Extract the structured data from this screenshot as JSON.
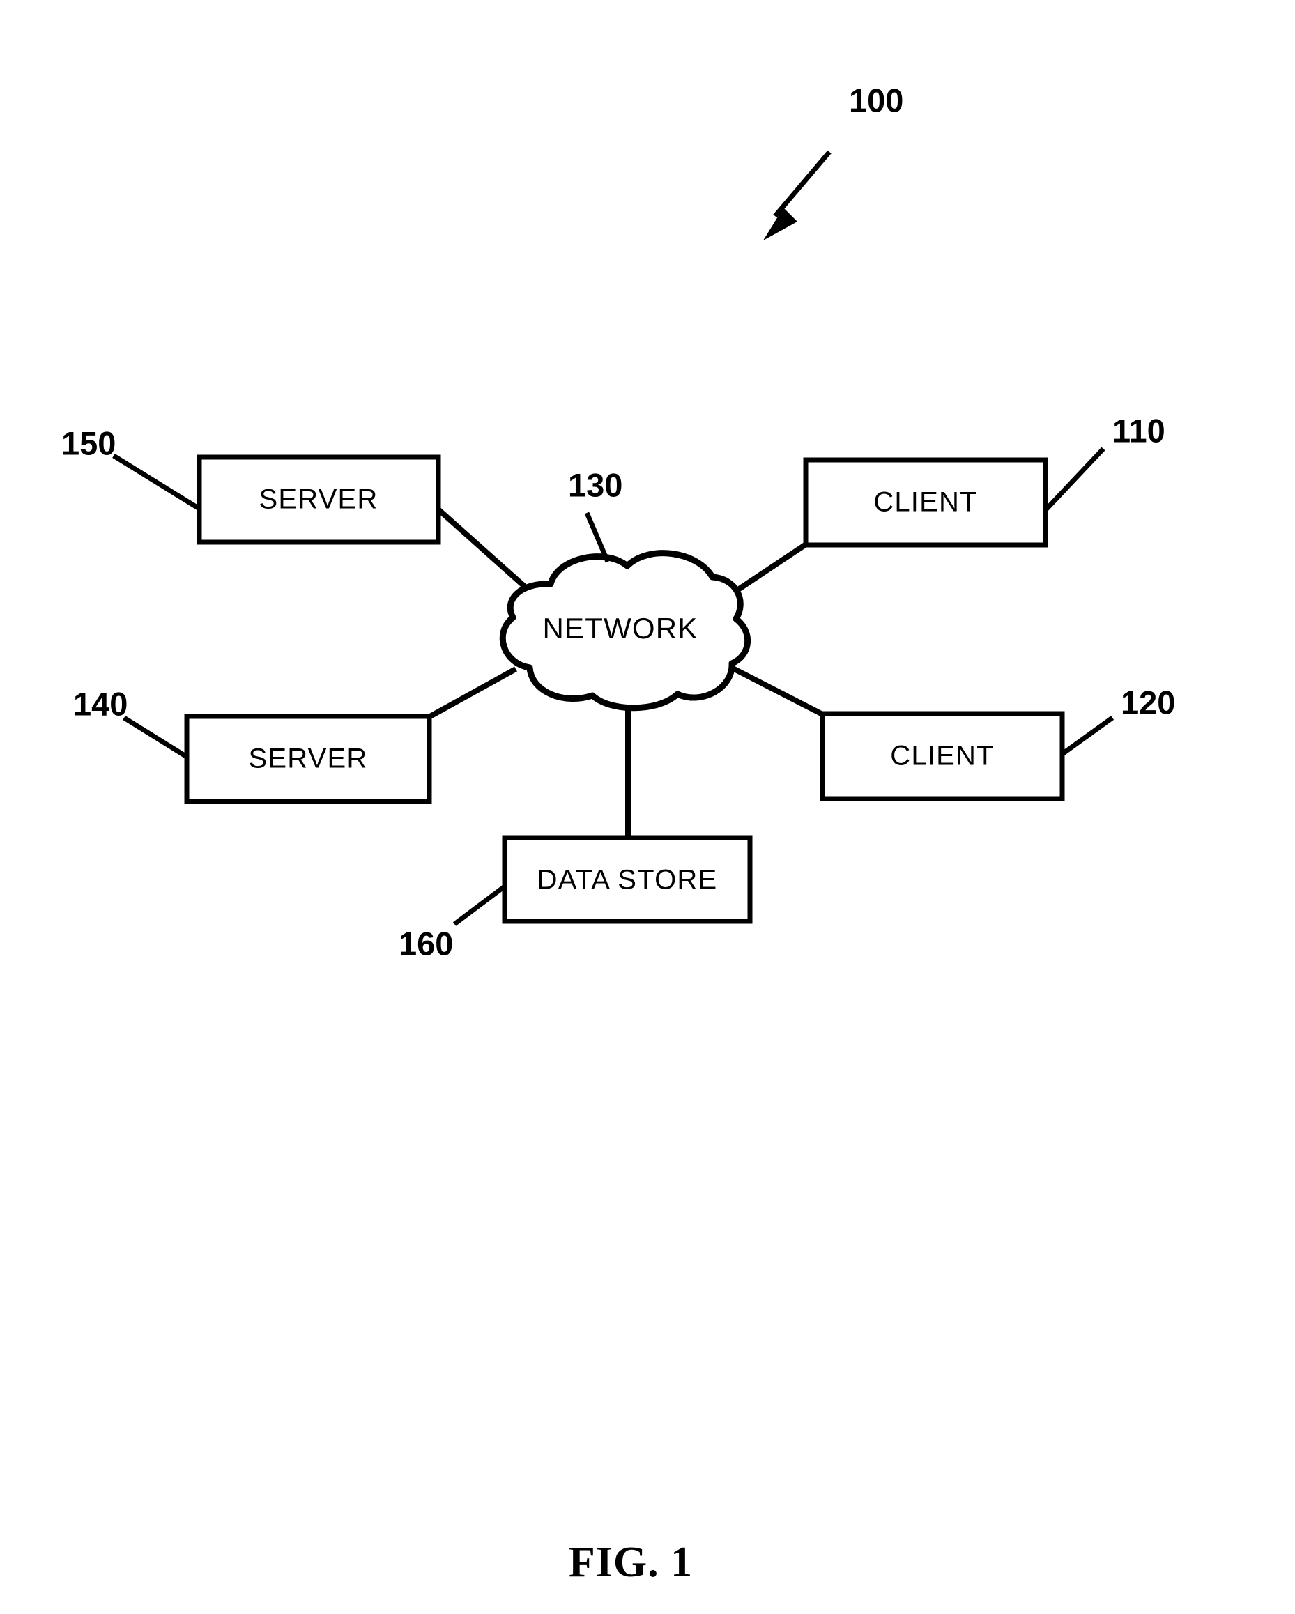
{
  "figure": {
    "caption": "FIG. 1",
    "system_reference": "100"
  },
  "network": {
    "label": "NETWORK",
    "reference": "130"
  },
  "nodes": [
    {
      "id": "server-150",
      "label": "SERVER",
      "reference": "150"
    },
    {
      "id": "server-140",
      "label": "SERVER",
      "reference": "140"
    },
    {
      "id": "client-110",
      "label": "CLIENT",
      "reference": "110"
    },
    {
      "id": "client-120",
      "label": "CLIENT",
      "reference": "120"
    },
    {
      "id": "data-store-160",
      "label": "DATA STORE",
      "reference": "160"
    }
  ],
  "connections": [
    {
      "from": "server-150",
      "to": "network"
    },
    {
      "from": "server-140",
      "to": "network"
    },
    {
      "from": "client-110",
      "to": "network"
    },
    {
      "from": "client-120",
      "to": "network"
    },
    {
      "from": "data-store-160",
      "to": "network"
    }
  ],
  "colors": {
    "ink": "#000000",
    "background": "#ffffff"
  }
}
